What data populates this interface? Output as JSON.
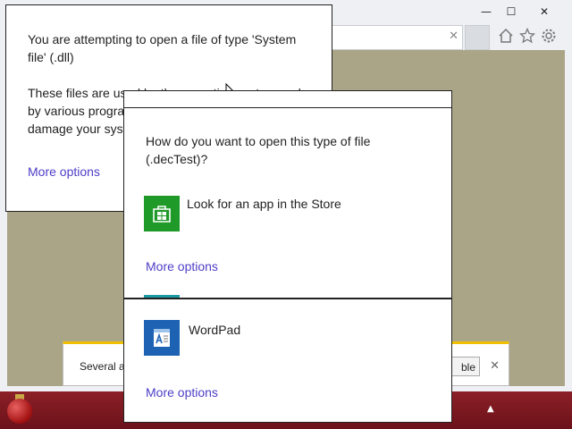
{
  "window": {
    "minimize_glyph": "—",
    "maximize_glyph": "☐",
    "close_glyph": "✕"
  },
  "address_bar": {
    "clear_glyph": "✕"
  },
  "toolbar": {
    "home_icon": "home-icon",
    "favorites_icon": "star-icon",
    "settings_icon": "gear-icon"
  },
  "dialog_system_file": {
    "message_1": "You are attempting to open a file of type 'System file' (.dll)",
    "message_2": "These files are used by the operating system and by various programs. Editing or opening them could damage your system.",
    "more_options": "More options"
  },
  "dialog_open_with": {
    "question": "How do you want to open this type of file (.decTest)?",
    "store_option": "Look for an app in the Store",
    "more_options_1": "More options",
    "wordpad_option": "WordPad",
    "more_options_2": "More options"
  },
  "notification": {
    "text": "Several ad",
    "button_label": "ble",
    "close_glyph": "✕"
  },
  "taskbar": {
    "tray_arrow": "▲"
  },
  "colors": {
    "link": "#4d3ec7",
    "store_tile": "#1f9a28",
    "wordpad_tile": "#1e63b3",
    "taskbar": "#7d1820",
    "page_background": "#aba587"
  }
}
